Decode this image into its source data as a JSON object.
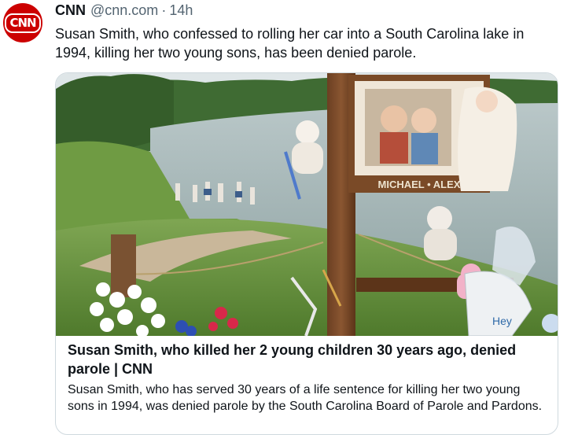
{
  "account": {
    "avatar_text": "CNN",
    "name": "CNN",
    "handle": "@cnn.com",
    "separator": "·",
    "time": "14h",
    "brand_color": "#cc0000"
  },
  "post": {
    "text": "Susan Smith, who confessed to rolling her car into a South Carolina lake in 1994, killing her two young sons, has been denied parole."
  },
  "card": {
    "image_sign_text": "MICHAEL • ALEX",
    "image_balloon_text": "Hey",
    "title": "Susan Smith, who killed her 2 young children 30 years ago, denied parole | CNN",
    "description": "Susan Smith, who has served 30 years of a life sentence for killing her two young sons in 1994, was denied parole by the South Carolina Board of Parole and Pardons."
  }
}
